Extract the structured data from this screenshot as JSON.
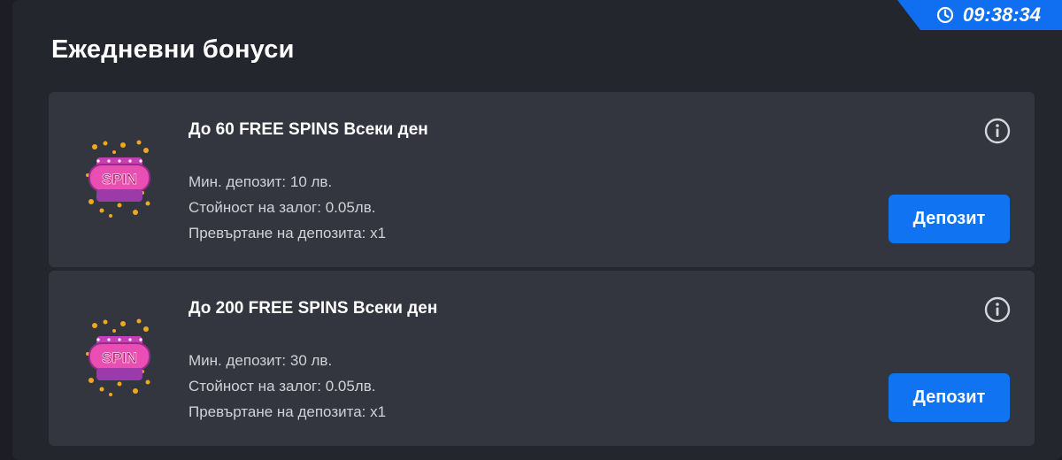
{
  "timer": {
    "time": "09:38:34",
    "icon": "clock-icon"
  },
  "section": {
    "title": "Ежедневни бонуси"
  },
  "bonuses": [
    {
      "title": "До 60 FREE SPINS Всеки ден",
      "min_deposit": "Мин. депозит: 10 лв.",
      "bet_value": "Стойност на залог: 0.05лв.",
      "wagering": "Превъртане на депозита: x1",
      "button_label": "Депозит",
      "image_text": "SPIN"
    },
    {
      "title": "До 200 FREE SPINS Всеки ден",
      "min_deposit": "Мин. депозит: 30 лв.",
      "bet_value": "Стойност на залог: 0.05лв.",
      "wagering": "Превъртане на депозита: x1",
      "button_label": "Депозит",
      "image_text": "SPIN"
    }
  ],
  "colors": {
    "accent": "#0f73f2",
    "card": "#33363f",
    "panel": "#24262d"
  }
}
